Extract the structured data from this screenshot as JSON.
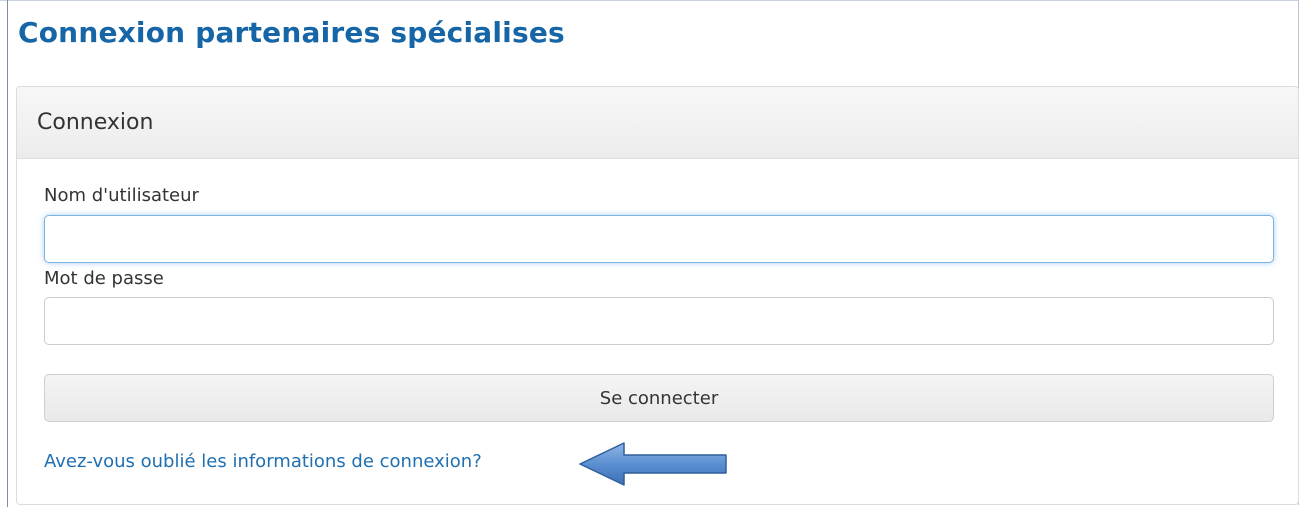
{
  "page": {
    "title": "Connexion partenaires spécialises"
  },
  "panel": {
    "title": "Connexion",
    "username_label": "Nom d'utilisateur",
    "username_value": "",
    "password_label": "Mot de passe",
    "password_value": "",
    "submit_label": "Se connecter",
    "forgot_link": "Avez-vous oublié les informations de connexion?"
  },
  "colors": {
    "title": "#1666a7",
    "link": "#1f6fb2",
    "arrow_fill": "#5b8fd1",
    "arrow_stroke": "#2e5f9e"
  },
  "icons": {
    "annotation": "left-arrow-icon"
  }
}
